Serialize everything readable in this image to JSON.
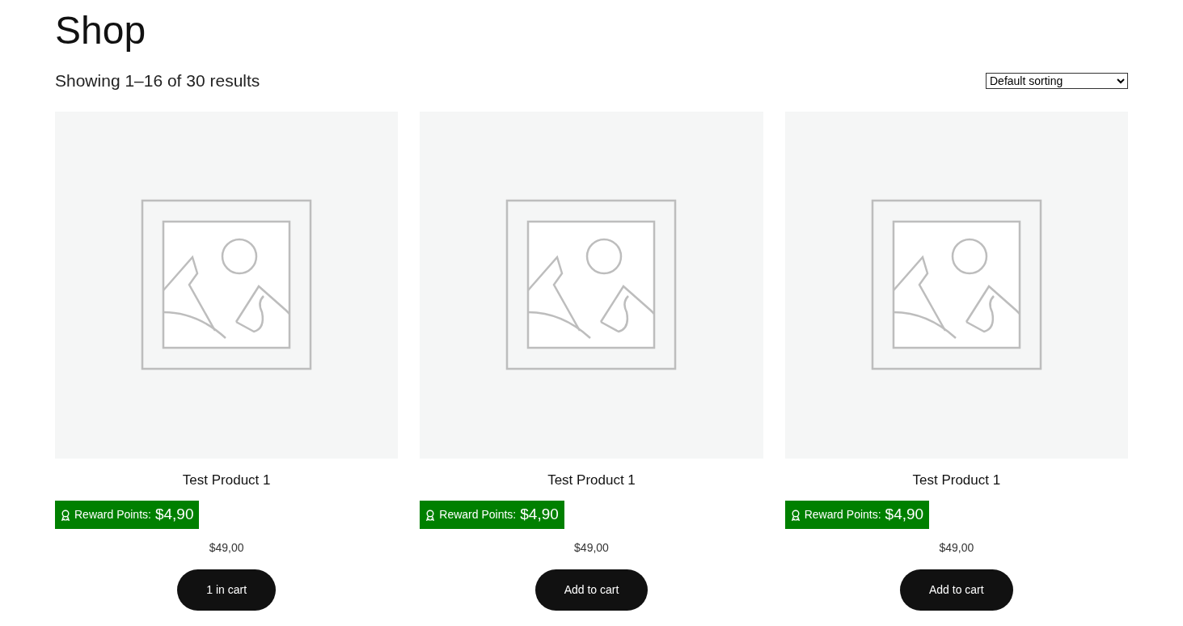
{
  "page_title": "Shop",
  "result_count": "Showing 1–16 of 30 results",
  "sorting": {
    "value": "Default sorting"
  },
  "products": [
    {
      "name": "Test Product 1",
      "reward_label": "Reward Points:",
      "reward_value": "$4,90",
      "price": "$49,00",
      "button": "1 in cart"
    },
    {
      "name": "Test Product 1",
      "reward_label": "Reward Points:",
      "reward_value": "$4,90",
      "price": "$49,00",
      "button": "Add to cart"
    },
    {
      "name": "Test Product 1",
      "reward_label": "Reward Points:",
      "reward_value": "$4,90",
      "price": "$49,00",
      "button": "Add to cart"
    }
  ]
}
